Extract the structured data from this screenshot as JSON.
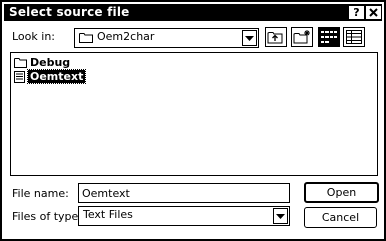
{
  "window": {
    "title": "Select source file",
    "help_label": "?",
    "close_label": "X"
  },
  "look_in": {
    "label": "Look in:",
    "value": "Oem2char",
    "folder_icon": "folder-icon"
  },
  "toolbar": {
    "up_icon": "up-one-level-icon",
    "new_folder_icon": "new-folder-icon",
    "list_icon": "list-view-icon",
    "details_icon": "details-view-icon"
  },
  "files": [
    {
      "name": "Debug",
      "type": "folder"
    },
    {
      "name": "Oemtext",
      "type": "file",
      "selected": true
    }
  ],
  "file_name": {
    "label": "File name:",
    "value": "Oemtext"
  },
  "file_type": {
    "label": "Files of type:",
    "value": "Text Files"
  },
  "buttons": {
    "open": "Open",
    "cancel": "Cancel"
  }
}
